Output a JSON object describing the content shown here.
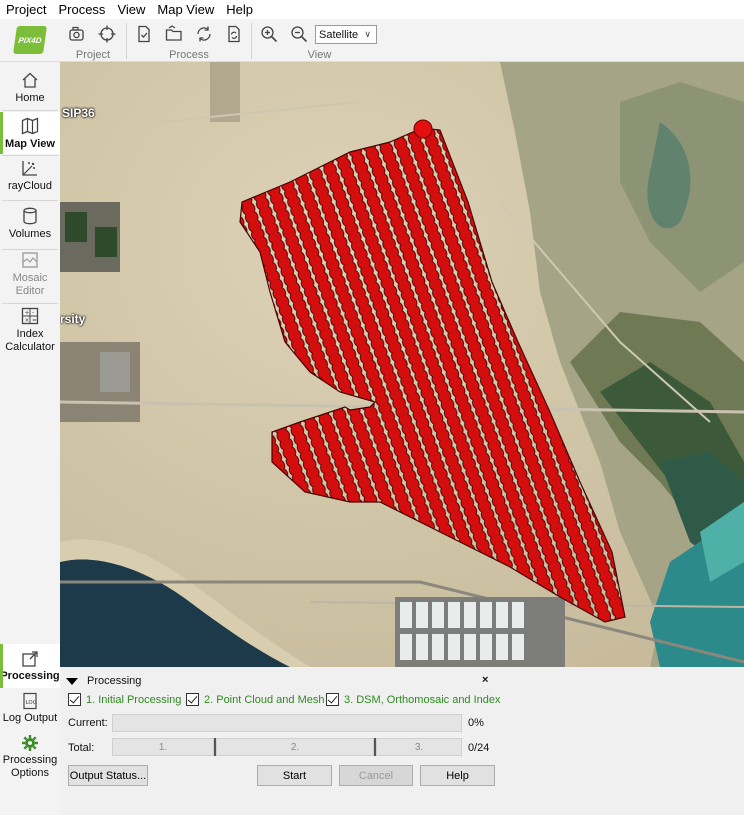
{
  "menu": [
    "Project",
    "Process",
    "View",
    "Map View",
    "Help"
  ],
  "logo_text": "PIX4D",
  "toolbar": {
    "groups": [
      {
        "label": "Project"
      },
      {
        "label": "Process"
      },
      {
        "label": "View"
      }
    ],
    "basemap_select": "Satellite"
  },
  "sidebar": {
    "items": [
      {
        "label": "Home",
        "icon": "home-icon"
      },
      {
        "label": "Map View",
        "icon": "map-icon",
        "active": true
      },
      {
        "label": "rayCloud",
        "icon": "raycloud-icon"
      },
      {
        "label": "Volumes",
        "icon": "volumes-icon"
      },
      {
        "label": "Mosaic Editor",
        "icon": "mosaic-editor-icon",
        "disabled": true
      },
      {
        "label": "Index Calculator",
        "icon": "index-calculator-icon"
      }
    ]
  },
  "bottom_sidebar": {
    "items": [
      {
        "label": "Processing",
        "icon": "processing-icon",
        "active": true
      },
      {
        "label": "Log Output",
        "icon": "log-icon"
      },
      {
        "label": "Processing Options",
        "icon": "gear-icon"
      }
    ]
  },
  "map": {
    "labels": [
      "SIP36",
      "rsity"
    ],
    "marker_color": "#dd0d0d"
  },
  "processing": {
    "title": "Processing",
    "close": "×",
    "steps": [
      {
        "label": "1. Initial Processing",
        "checked": true
      },
      {
        "label": "2. Point Cloud and Mesh",
        "checked": true
      },
      {
        "label": "3. DSM, Orthomosaic and Index",
        "checked": true
      }
    ],
    "current_label": "Current:",
    "current_value": "0%",
    "total_label": "Total:",
    "total_value": "0/24",
    "total_segments": [
      "1.",
      "2.",
      "3."
    ],
    "buttons": {
      "output_status": "Output Status...",
      "start": "Start",
      "cancel": "Cancel",
      "help": "Help"
    }
  }
}
